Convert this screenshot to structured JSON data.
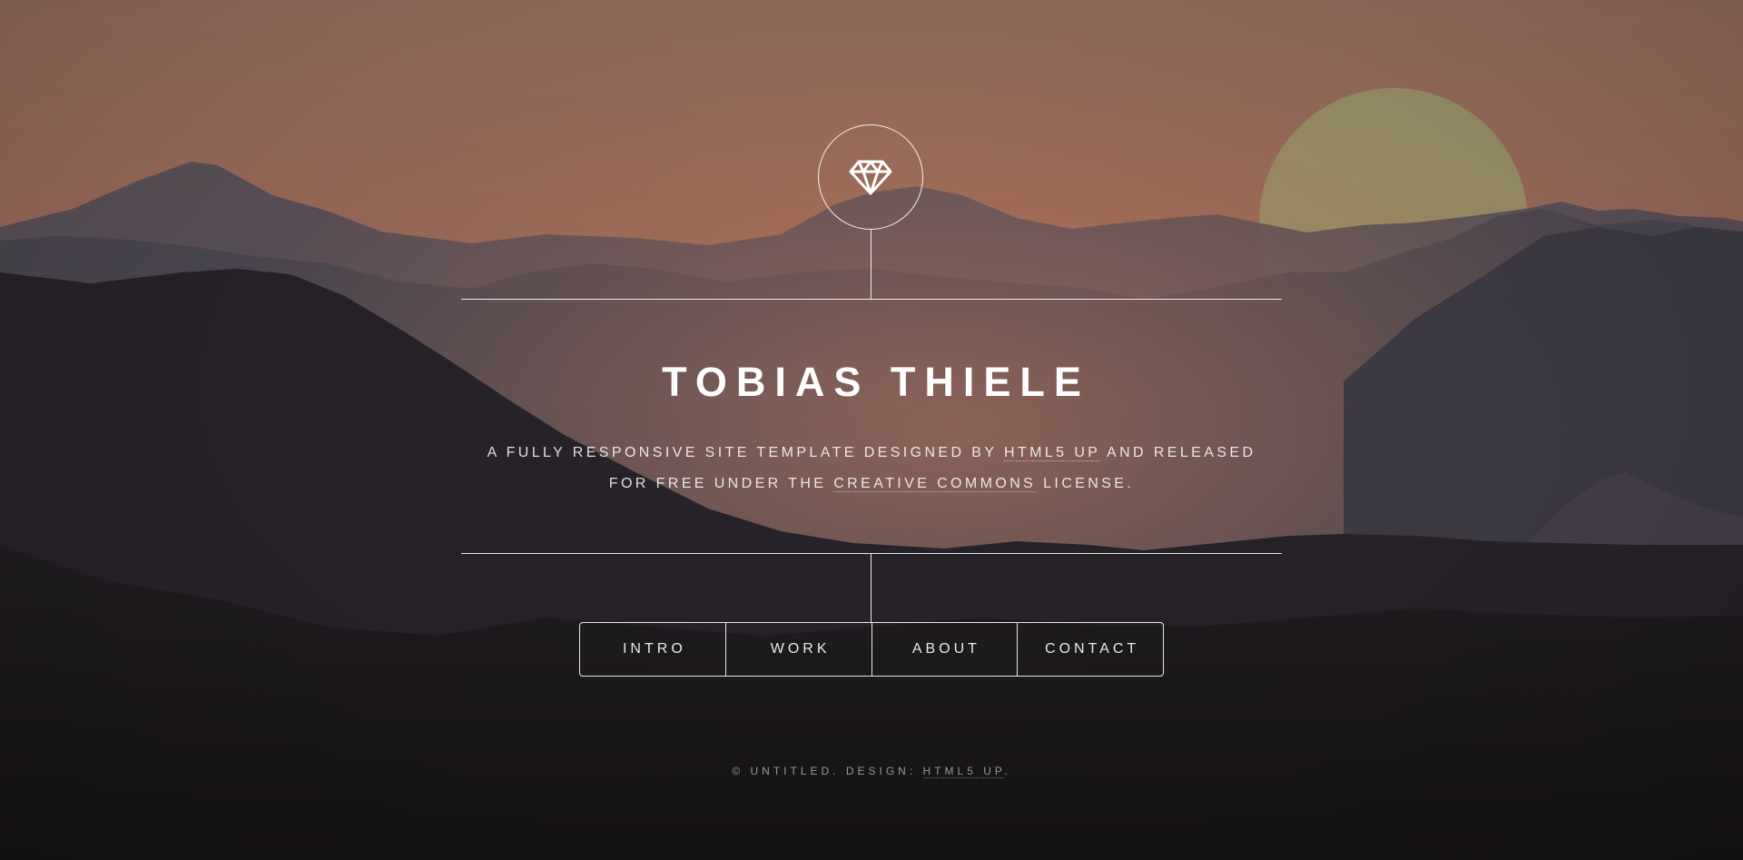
{
  "header": {
    "logo_icon": "diamond-icon",
    "title": "TOBIAS THIELE",
    "description": {
      "part1": "A FULLY RESPONSIVE SITE TEMPLATE DESIGNED BY ",
      "link1": "HTML5 UP",
      "part2": " AND RELEASED",
      "part3": "FOR FREE UNDER THE ",
      "link2": "CREATIVE COMMONS",
      "part4": " LICENSE."
    }
  },
  "nav": {
    "items": [
      {
        "label": "INTRO"
      },
      {
        "label": "WORK"
      },
      {
        "label": "ABOUT"
      },
      {
        "label": "CONTACT"
      }
    ]
  },
  "footer": {
    "copyright": "© UNTITLED. DESIGN: ",
    "link": "HTML5 UP",
    "end": "."
  },
  "colors": {
    "sky_top": "#987062",
    "sky_mid": "#a06a55",
    "sun": "#9a9a6a",
    "mountain_far": "#4c4a56",
    "mountain_dark": "#1d1a1e",
    "foreground": "#1b1719"
  }
}
